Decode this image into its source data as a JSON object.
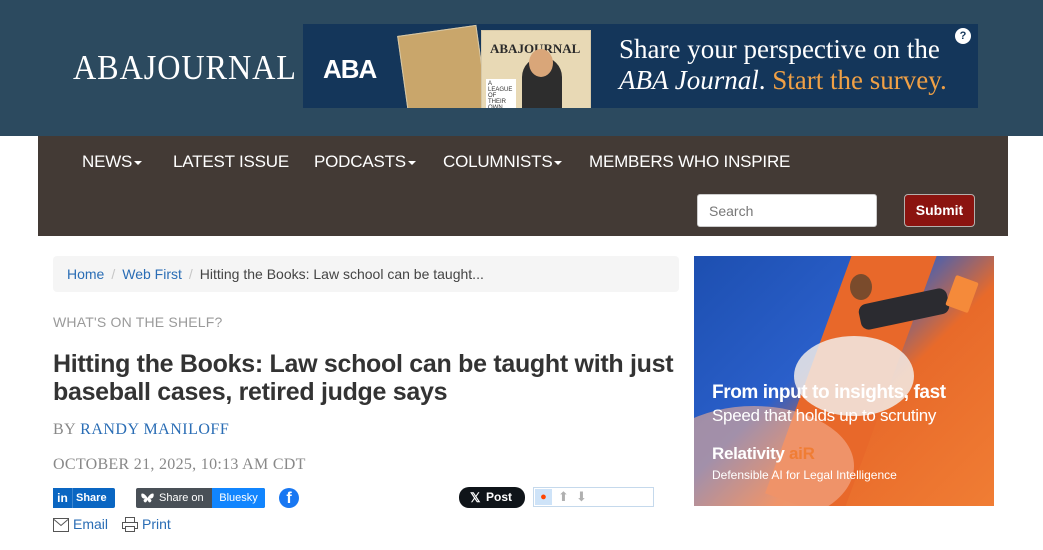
{
  "header": {
    "logo_text": "ABAJOURNAL",
    "banner": {
      "brand": "ABA",
      "cover_title": "ABAJOURNAL",
      "cover_tag": "A LEAGUE OF THEIR OWN",
      "line1": "Share your perspective on the",
      "line2_italic": "ABA Journal",
      "line2_end": ".",
      "line2_highlight": "Start the survey.",
      "help_icon": "?"
    }
  },
  "nav": {
    "items": [
      {
        "label": "NEWS",
        "dropdown": true
      },
      {
        "label": "LATEST ISSUE",
        "dropdown": false
      },
      {
        "label": "PODCASTS",
        "dropdown": true
      },
      {
        "label": "COLUMNISTS",
        "dropdown": true
      },
      {
        "label": "MEMBERS WHO INSPIRE",
        "dropdown": false
      }
    ],
    "search_placeholder": "Search",
    "search_value": "",
    "submit_label": "Submit"
  },
  "breadcrumb": {
    "items": [
      "Home",
      "Web First"
    ],
    "current": "Hitting the Books: Law school can be taught..."
  },
  "article": {
    "kicker": "WHAT'S ON THE SHELF?",
    "headline": "Hitting the Books: Law school can be taught with just baseball cases, retired judge says",
    "by_prefix": "BY",
    "author": "RANDY MANILOFF",
    "date": "OCTOBER 21, 2025, 10:13 AM CDT"
  },
  "share": {
    "linkedin_logo": "in",
    "linkedin_label": "Share",
    "bluesky_label_1": "Share on",
    "bluesky_label_2": "Bluesky",
    "facebook_glyph": "f",
    "x_glyph": "𝕏",
    "x_label": "Post",
    "email_label": "Email",
    "print_label": "Print"
  },
  "ad": {
    "title": "From input to insights, fast",
    "subtitle": "Speed that holds up to scrutiny",
    "brand_main": "Relativity",
    "brand_suffix": "aiR",
    "tagline": "Defensible AI for Legal Intelligence"
  },
  "colors": {
    "header_bg": "#2c4a5f",
    "nav_bg": "#433a35",
    "submit_bg": "#8b1410",
    "link": "#2a6db5",
    "banner_highlight": "#f0a045"
  }
}
